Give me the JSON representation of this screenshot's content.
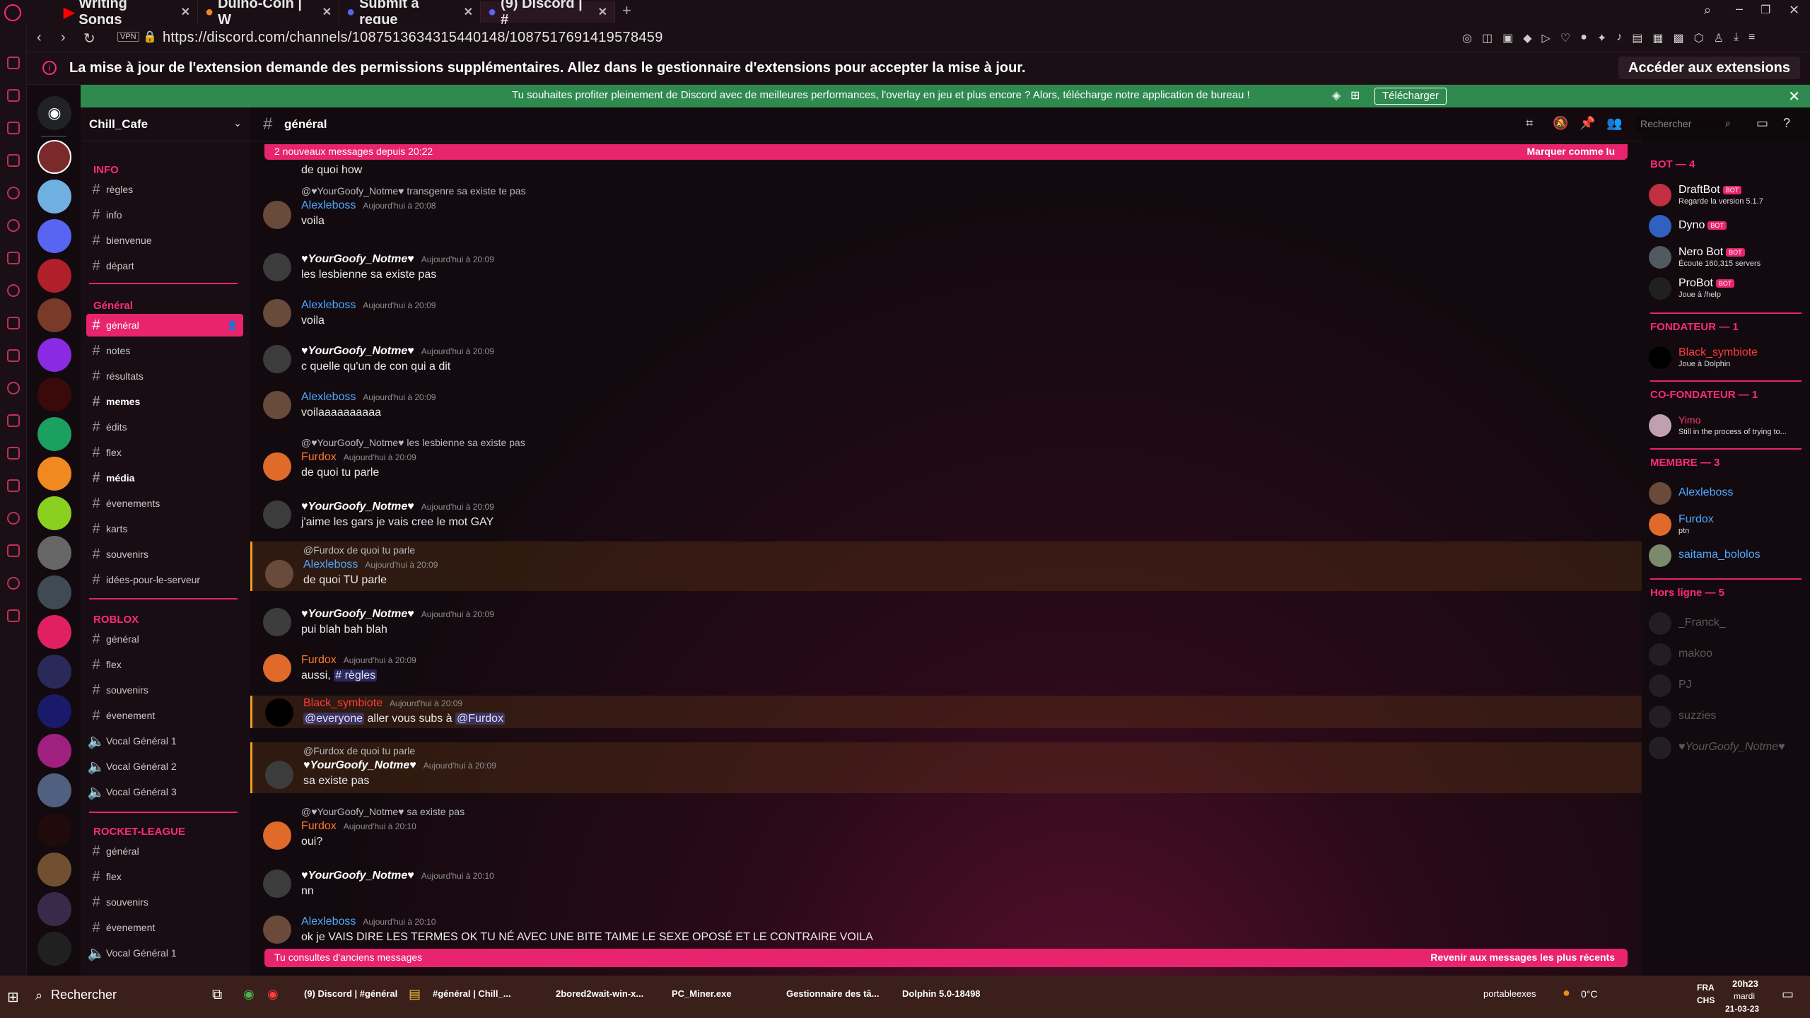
{
  "browser": {
    "tabs": [
      "Writing Songs",
      "Duino-Coin | W",
      "Submit a reque",
      "(9) Discord | #"
    ],
    "url": "https://discord.com/channels/1087513634315440148/1087517691419578459",
    "vpn": "VPN",
    "notification": "La mise à jour de l'extension demande des permissions supplémentaires. Allez dans le gestionnaire d'extensions pour accepter la mise à jour.",
    "notification_button": "Accéder aux extensions"
  },
  "banner": {
    "text": "Tu souhaites profiter pleinement de Discord avec de meilleures performances, l'overlay en jeu et plus encore ? Alors, télécharge notre application de bureau !",
    "button": "Télécharger"
  },
  "server": {
    "name": "Chill_Cafe"
  },
  "categories": [
    {
      "name": "INFO",
      "channels": [
        "règles",
        "info",
        "bienvenue",
        "départ"
      ]
    },
    {
      "name": "Général",
      "channels": [
        "général",
        "notes",
        "résultats",
        "memes",
        "édits",
        "flex",
        "média",
        "évenements",
        "karts",
        "souvenirs",
        "idées-pour-le-serveur"
      ]
    },
    {
      "name": "ROBLOX",
      "channels": [
        "général",
        "flex",
        "souvenirs",
        "évenement",
        "Vocal Général 1",
        "Vocal Général 2",
        "Vocal Général 3"
      ]
    },
    {
      "name": "ROCKET-LEAGUE",
      "channels": [
        "général",
        "flex",
        "souvenirs",
        "évenement",
        "Vocal Général 1"
      ]
    }
  ],
  "channel": {
    "title": "général",
    "search_placeholder": "Rechercher"
  },
  "new_messages": {
    "text": "2 nouveaux messages depuis 20:22",
    "action": "Marquer comme lu"
  },
  "messages": [
    {
      "text": "de quoi how"
    },
    {
      "reply": "@♥YourGoofy_Notme♥ transgenre sa existe te pas",
      "author": "Alexleboss",
      "ts": "Aujourd'hui à 20:08",
      "text": "voila"
    },
    {
      "author": "♥YourGoofy_Notme♥",
      "ts": "Aujourd'hui à 20:09",
      "text": "les lesbienne sa existe pas"
    },
    {
      "author": "Alexleboss",
      "ts": "Aujourd'hui à 20:09",
      "text": "voila"
    },
    {
      "author": "♥YourGoofy_Notme♥",
      "ts": "Aujourd'hui à 20:09",
      "text": "c quelle qu'un de con qui a dit"
    },
    {
      "author": "Alexleboss",
      "ts": "Aujourd'hui à 20:09",
      "text": "voilaaaaaaaaaa"
    },
    {
      "reply": "@♥YourGoofy_Notme♥ les lesbienne sa existe pas",
      "author": "Furdox",
      "ts": "Aujourd'hui à 20:09",
      "text": "de quoi tu parle"
    },
    {
      "author": "♥YourGoofy_Notme♥",
      "ts": "Aujourd'hui à 20:09",
      "text": "j'aime les gars je vais cree le mot GAY"
    },
    {
      "reply": "@Furdox de quoi tu parle",
      "author": "Alexleboss",
      "ts": "Aujourd'hui à 20:09",
      "text": "de quoi TU parle"
    },
    {
      "author": "♥YourGoofy_Notme♥",
      "ts": "Aujourd'hui à 20:09",
      "text": "pui blah bah blah"
    },
    {
      "author": "Furdox",
      "ts": "Aujourd'hui à 20:09",
      "text": "aussi,",
      "mention": "# règles"
    },
    {
      "author": "Black_symbiote",
      "ts": "Aujourd'hui à 20:09",
      "mention": "@everyone",
      "text": "aller vous subs à",
      "mention2": "@Furdox"
    },
    {
      "reply": "@Furdox de quoi tu parle",
      "author": "♥YourGoofy_Notme♥",
      "ts": "Aujourd'hui à 20:09",
      "text": "sa existe pas"
    },
    {
      "reply": "@♥YourGoofy_Notme♥ sa existe pas",
      "author": "Furdox",
      "ts": "Aujourd'hui à 20:10",
      "text": "oui?"
    },
    {
      "author": "♥YourGoofy_Notme♥",
      "ts": "Aujourd'hui à 20:10",
      "text": "nn"
    },
    {
      "author": "Alexleboss",
      "ts": "Aujourd'hui à 20:10",
      "text": "ok je VAIS DIRE LES TERMES OK TU NÉ AVEC UNE BITE TAIME LE SEXE OPOSÉ ET LE CONTRAIRE VOILA"
    }
  ],
  "old_messages": {
    "text": "Tu consultes d'anciens messages",
    "action": "Revenir aux messages les plus récents"
  },
  "members": {
    "bot_header": "BOT — 4",
    "bots": [
      {
        "name": "DraftBot",
        "status": "Regarde la version 5.1.7"
      },
      {
        "name": "Dyno",
        "status": ""
      },
      {
        "name": "Nero Bot",
        "status": "Écoute 160,315 servers"
      },
      {
        "name": "ProBot",
        "status": "Joue à /help"
      }
    ],
    "founder_header": "FONDATEUR — 1",
    "founder": {
      "name": "Black_symbiote",
      "status": "Joue à Dolphin"
    },
    "cofounder_header": "CO-FONDATEUR — 1",
    "cofounder": {
      "name": "Yimo",
      "status": "Still in the process of trying to..."
    },
    "member_header": "MEMBRE — 3",
    "members": [
      {
        "name": "Alexleboss",
        "status": ""
      },
      {
        "name": "Furdox",
        "status": "ptn"
      },
      {
        "name": "saitama_bololos",
        "status": ""
      }
    ],
    "offline_header": "Hors ligne — 5",
    "offline": [
      "_Franck_",
      "makoo",
      "PJ",
      "suzzies",
      "♥YourGoofy_Notme♥"
    ],
    "bot_badge": "BOT"
  },
  "taskbar": {
    "search": "Rechercher",
    "apps": [
      "(9) Discord | #général",
      "#général | Chill_...",
      "2bored2wait-win-x...",
      "PC_Miner.exe",
      "Gestionnaire des tâ...",
      "Dolphin 5.0-18498"
    ],
    "tray_user": "portableexes",
    "temp": "0°C",
    "lang": "FRA",
    "kbd": "CHS",
    "time": "20h23",
    "day": "mardi",
    "date": "21-03-23"
  },
  "colors": {
    "accent": "#e8246e",
    "banner": "#2f8a4f"
  }
}
